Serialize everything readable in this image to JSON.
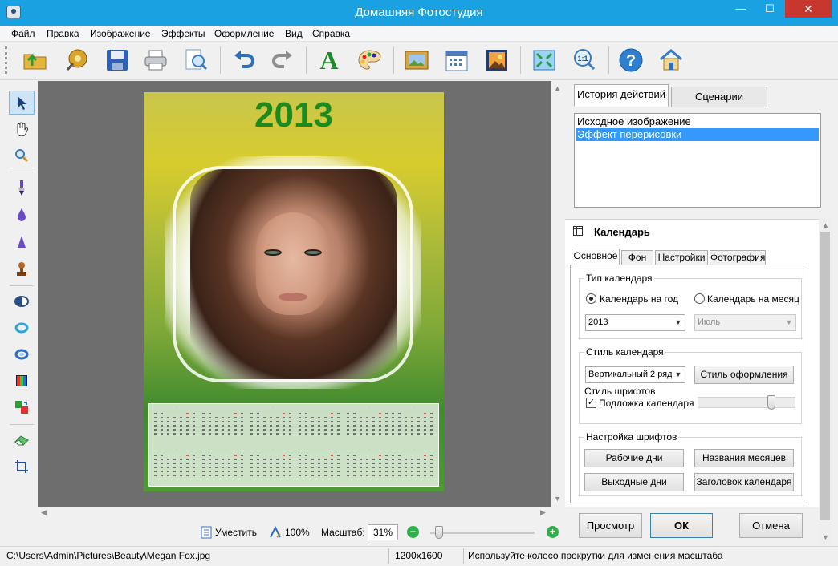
{
  "window": {
    "title": "Домашняя Фотостудия",
    "controls": {
      "minimize": "—",
      "maximize": "☐",
      "close": "✕"
    }
  },
  "menu": [
    "Файл",
    "Правка",
    "Изображение",
    "Эффекты",
    "Оформление",
    "Вид",
    "Справка"
  ],
  "toolbar": {
    "icons": [
      "open-folder-icon",
      "effects-wheel-icon",
      "save-icon",
      "print-icon",
      "preview-icon",
      "undo-icon",
      "redo-icon",
      "text-icon",
      "palette-icon",
      "frame-icon",
      "calendar-icon",
      "postcard-icon",
      "fit-icon",
      "actual-size-icon",
      "help-icon",
      "home-icon"
    ],
    "text_glyph": "A",
    "help_glyph": "?",
    "actual_size_glyph": "1:1"
  },
  "tools": [
    "pointer-icon",
    "hand-icon",
    "zoom-icon",
    "brush-icon",
    "blur-icon",
    "sharpen-icon",
    "stamp-icon",
    "dodge-icon",
    "ring-icon",
    "ring2-icon",
    "levels-icon",
    "swap-icon",
    "eraser-icon",
    "crop-icon"
  ],
  "canvas": {
    "year": "2013"
  },
  "history": {
    "tabs": [
      "История действий",
      "Сценарии"
    ],
    "items": [
      "Исходное изображение",
      "Эффект перерисовки"
    ],
    "selected_index": 1
  },
  "calendar_panel": {
    "title": "Календарь",
    "tabs": [
      "Основное",
      "Фон",
      "Настройки",
      "Фотография"
    ],
    "type_group": {
      "title": "Тип календаря",
      "year_label": "Календарь на год",
      "month_label": "Календарь на месяц",
      "selected": "year",
      "year_value": "2013",
      "month_value": "Июль"
    },
    "style_group": {
      "title": "Стиль календаря",
      "style_value": "Вертикальный 2 ряд",
      "style_button": "Стиль оформления",
      "fonts_style_label": "Стиль шрифтов",
      "backing_label": "Подложка календаря",
      "backing_checked": true,
      "backing_opacity": 0.78
    },
    "fonts_group": {
      "title": "Настройка шрифтов",
      "workdays": "Рабочие дни",
      "month_names": "Названия месяцев",
      "weekends": "Выходные дни",
      "calendar_header": "Заголовок календаря"
    }
  },
  "dialog_buttons": {
    "preview": "Просмотр",
    "ok": "ОК",
    "cancel": "Отмена"
  },
  "zoombar": {
    "fit": "Уместить",
    "actual": "100%",
    "scale_label": "Масштаб:",
    "scale_value": "31%",
    "minus": "−",
    "plus": "+",
    "zoom_level": 0.05
  },
  "status": {
    "path": "C:\\Users\\Admin\\Pictures\\Beauty\\Megan Fox.jpg",
    "size": "1200x1600",
    "hint": "Используйте колесо прокрутки для изменения масштаба"
  },
  "colors": {
    "titlebar": "#1aa1e2",
    "close": "#c7372f",
    "selection": "#3399ff",
    "year": "#1c8a1e",
    "zoom_button": "#2fb14a"
  }
}
